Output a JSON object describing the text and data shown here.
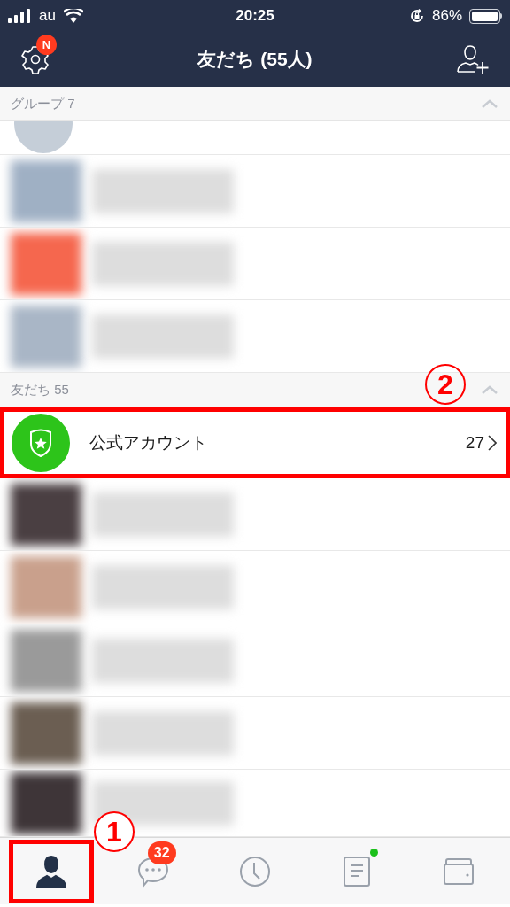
{
  "status_bar": {
    "carrier": "au",
    "time": "20:25",
    "battery": "86%"
  },
  "header": {
    "title": "友だち (55人)",
    "settings_badge": "N"
  },
  "groups": {
    "label": "グループ 7",
    "expanded": true,
    "rows": [
      {
        "kind": "partial",
        "color": "#c5ced8"
      },
      {
        "kind": "blurred",
        "color": "#9fb0c4"
      },
      {
        "kind": "blurred",
        "color": "#f5674e"
      },
      {
        "kind": "blurred",
        "color": "#a9b6c6"
      }
    ]
  },
  "friends": {
    "label": "友だち 55",
    "expanded": true,
    "annotation": "2",
    "official": {
      "name": "公式アカウント",
      "count": "27",
      "highlighted": true
    },
    "rows": [
      {
        "kind": "blurred",
        "color": "#4a3f42"
      },
      {
        "kind": "blurred",
        "color": "#c9a08c"
      },
      {
        "kind": "blurred",
        "color": "#9a9a9a"
      },
      {
        "kind": "blurred",
        "color": "#6b5e52"
      },
      {
        "kind": "blurred",
        "color": "#3e3538"
      }
    ]
  },
  "tabs": [
    {
      "kind": "friends",
      "selected": true,
      "highlighted": true,
      "annotation": "1"
    },
    {
      "kind": "chats",
      "selected": false,
      "badge": "32"
    },
    {
      "kind": "timeline",
      "selected": false
    },
    {
      "kind": "news",
      "selected": false,
      "dot": true
    },
    {
      "kind": "wallet",
      "selected": false
    }
  ]
}
